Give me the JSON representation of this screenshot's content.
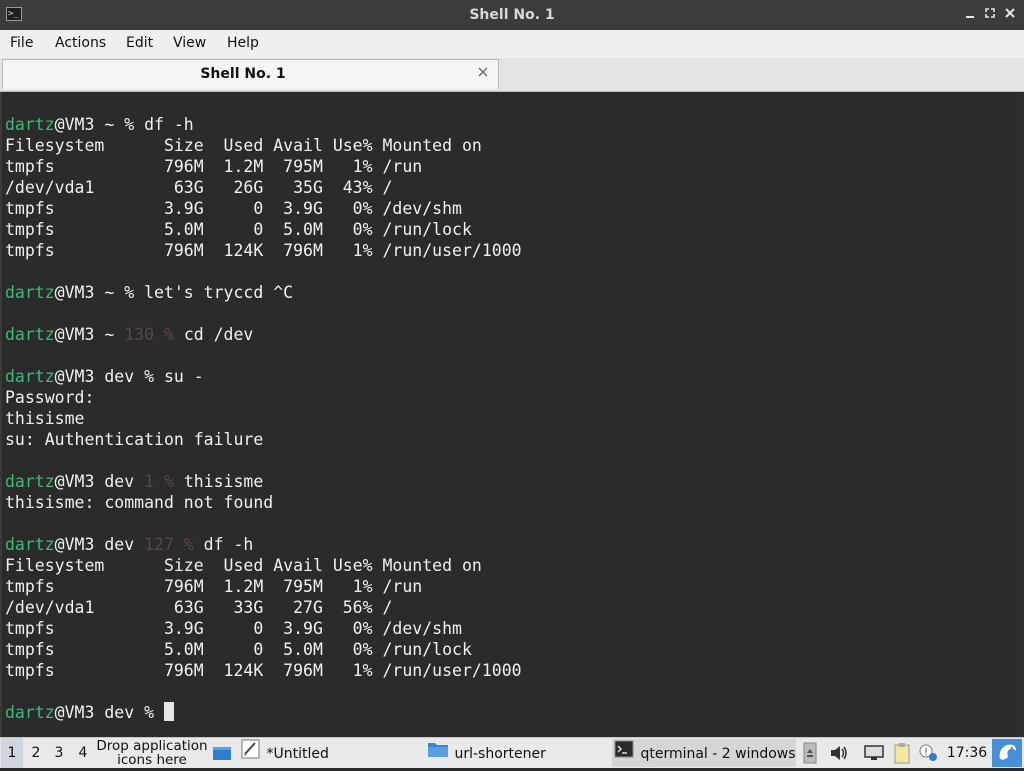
{
  "window": {
    "title": "Shell No. 1",
    "icon": "terminal-icon",
    "controls": [
      "minimize-icon",
      "maximize-icon",
      "close-icon"
    ]
  },
  "menubar": {
    "items": [
      "File",
      "Actions",
      "Edit",
      "View",
      "Help"
    ]
  },
  "tabs": [
    {
      "label": "Shell No. 1",
      "close_icon": "close-icon"
    }
  ],
  "terminal": {
    "lines": [
      [
        {
          "t": "dartz",
          "c": "user"
        },
        {
          "t": "@VM3 ~ % df -h"
        }
      ],
      [
        {
          "t": "Filesystem      Size  Used Avail Use% Mounted on"
        }
      ],
      [
        {
          "t": "tmpfs           796M  1.2M  795M   1% /run"
        }
      ],
      [
        {
          "t": "/dev/vda1        63G   26G   35G  43% /"
        }
      ],
      [
        {
          "t": "tmpfs           3.9G     0  3.9G   0% /dev/shm"
        }
      ],
      [
        {
          "t": "tmpfs           5.0M     0  5.0M   0% /run/lock"
        }
      ],
      [
        {
          "t": "tmpfs           796M  124K  796M   1% /run/user/1000"
        }
      ],
      [
        {
          "t": ""
        }
      ],
      [
        {
          "t": "dartz",
          "c": "user"
        },
        {
          "t": "@VM3 ~ % let's tryccd ^C"
        }
      ],
      [
        {
          "t": ""
        }
      ],
      [
        {
          "t": "dartz",
          "c": "user"
        },
        {
          "t": "@VM3 ~ "
        },
        {
          "t": "130 %",
          "c": "dim"
        },
        {
          "t": " cd /dev"
        }
      ],
      [
        {
          "t": ""
        }
      ],
      [
        {
          "t": "dartz",
          "c": "user"
        },
        {
          "t": "@VM3 dev % su -"
        }
      ],
      [
        {
          "t": "Password:"
        }
      ],
      [
        {
          "t": "thisisme"
        }
      ],
      [
        {
          "t": "su: Authentication failure"
        }
      ],
      [
        {
          "t": ""
        }
      ],
      [
        {
          "t": "dartz",
          "c": "user"
        },
        {
          "t": "@VM3 dev "
        },
        {
          "t": "1 %",
          "c": "dim"
        },
        {
          "t": " thisisme"
        }
      ],
      [
        {
          "t": "thisisme: command not found"
        }
      ],
      [
        {
          "t": ""
        }
      ],
      [
        {
          "t": "dartz",
          "c": "user"
        },
        {
          "t": "@VM3 dev "
        },
        {
          "t": "127 %",
          "c": "dim"
        },
        {
          "t": " df -h"
        }
      ],
      [
        {
          "t": "Filesystem      Size  Used Avail Use% Mounted on"
        }
      ],
      [
        {
          "t": "tmpfs           796M  1.2M  795M   1% /run"
        }
      ],
      [
        {
          "t": "/dev/vda1        63G   33G   27G  56% /"
        }
      ],
      [
        {
          "t": "tmpfs           3.9G     0  3.9G   0% /dev/shm"
        }
      ],
      [
        {
          "t": "tmpfs           5.0M     0  5.0M   0% /run/lock"
        }
      ],
      [
        {
          "t": "tmpfs           796M  124K  796M   1% /run/user/1000"
        }
      ],
      [
        {
          "t": ""
        }
      ],
      [
        {
          "t": "dartz",
          "c": "user"
        },
        {
          "t": "@VM3 dev % "
        },
        {
          "cursor": true
        }
      ]
    ]
  },
  "taskbar": {
    "workspaces": [
      "1",
      "2",
      "3",
      "4"
    ],
    "active_workspace": "1",
    "drop_text_1": "Drop application",
    "drop_text_2": "icons here",
    "tasks": [
      {
        "label": "*Untitled",
        "icon": "text-editor-icon",
        "active": false
      },
      {
        "label": "url-shortener",
        "icon": "folder-icon",
        "active": false
      },
      {
        "label": "qterminal - 2 windows",
        "icon": "terminal-icon",
        "active": true
      }
    ],
    "tray": [
      "eject-icon",
      "volume-icon",
      "network-icon",
      "clipboard-icon",
      "notification-icon"
    ],
    "clock": "17:36",
    "launcher_icon": "lxqt-launcher-icon"
  },
  "colors": {
    "terminal_bg": "#2b2b2b",
    "terminal_fg": "#f0f0f0",
    "prompt_user": "#3cba7a",
    "exit_code": "#5a4646",
    "titlebar_bg": "#3b3c3d"
  }
}
